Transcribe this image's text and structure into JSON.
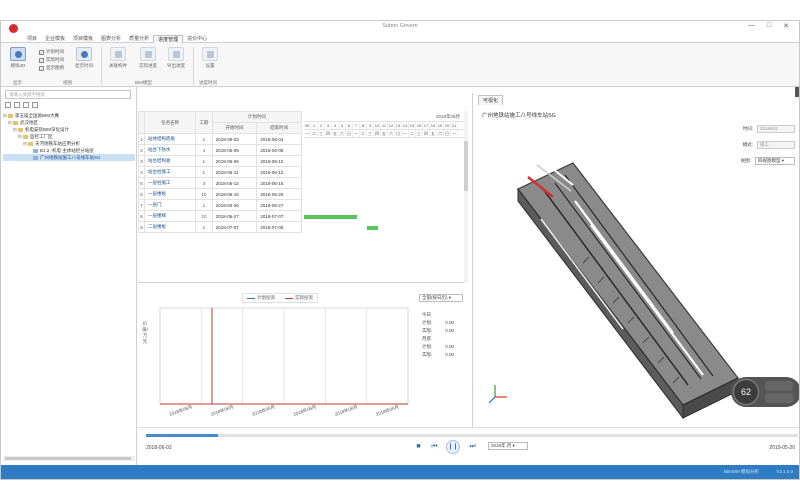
{
  "app": {
    "title": "Subon Govern",
    "status_text": "BimSIM 模拟分析",
    "version": "V3.1.0.0"
  },
  "window": {
    "minimize": "—",
    "maximize": "□",
    "close": "✕"
  },
  "menu": {
    "tabs": [
      "项目",
      "企业模板",
      "项目模板",
      "图表分析",
      "质量分析",
      "进度管理",
      "造价中心"
    ],
    "active_index": 5
  },
  "ribbon": {
    "buttons": [
      {
        "label": "模拟4D",
        "state": "active"
      },
      {
        "label": "显示时间",
        "state": "normal"
      },
      {
        "label": "关联构件",
        "state": "dim"
      },
      {
        "label": "实际进度",
        "state": "dim"
      },
      {
        "label": "导出进度",
        "state": "dim"
      },
      {
        "label": "设置",
        "state": "dim"
      }
    ],
    "checkboxes": [
      {
        "label": "计划时间",
        "checked": true
      },
      {
        "label": "实际时间",
        "checked": true
      },
      {
        "label": "显示图例",
        "checked": true
      }
    ],
    "groups": [
      "显示",
      "视图",
      "BIM模型",
      "进度时间"
    ]
  },
  "left_panel": {
    "search_placeholder": "请输入关键字搜索",
    "tree": [
      {
        "level": 0,
        "expander": "⊟",
        "folder": true,
        "label": "第五届全国质BIM大赛",
        "selected": false
      },
      {
        "level": 1,
        "expander": "⊟",
        "folder": true,
        "label": "武汉地区",
        "selected": false
      },
      {
        "level": 2,
        "expander": "⊟",
        "folder": true,
        "label": "机电安装BIM深化设计",
        "selected": false
      },
      {
        "level": 3,
        "expander": "⊟",
        "folder": true,
        "label": "监控工厂区",
        "selected": false
      },
      {
        "level": 4,
        "expander": "⊟",
        "folder": true,
        "label": "天河地铁车站应用分析",
        "selected": false
      },
      {
        "level": 5,
        "expander": "",
        "folder": false,
        "label": "B1.2 -机电 主体站控分站层",
        "selected": false
      },
      {
        "level": 5,
        "expander": "",
        "folder": false,
        "label": "广州地铁站施工八号线车站SG",
        "selected": true
      }
    ]
  },
  "gantt": {
    "headers": {
      "task": "任务名称",
      "duration": "工期",
      "plan": "计划时间",
      "start": "开始时间",
      "end": "结束时间"
    },
    "month": "2018年05月",
    "days": [
      "30",
      "1",
      "2",
      "3",
      "4",
      "5",
      "6",
      "7",
      "8",
      "9",
      "10",
      "11",
      "12",
      "13",
      "14",
      "15",
      "16",
      "17",
      "18",
      "19",
      "20",
      "21"
    ],
    "weekdays": [
      "一",
      "二",
      "三",
      "四",
      "五",
      "六",
      "日",
      "一",
      "二",
      "三",
      "四",
      "五",
      "六",
      "日",
      "一",
      "二",
      "三",
      "四",
      "五",
      "六",
      "日",
      "一"
    ],
    "rows": [
      {
        "id": "1",
        "name": "站体结构底板",
        "duration": "1",
        "start": "2018-06-03",
        "end": "2018-06-04"
      },
      {
        "id": "2",
        "name": "站台下防水",
        "duration": "4",
        "start": "2018-06-05",
        "end": "2018-06-08"
      },
      {
        "id": "3",
        "name": "站台结构板",
        "duration": "1",
        "start": "2018-06-09",
        "end": "2018-06-10"
      },
      {
        "id": "4",
        "name": "站台柱施工",
        "duration": "1",
        "start": "2018-06-11",
        "end": "2018-06-12"
      },
      {
        "id": "5",
        "name": "一层柱施工",
        "duration": "3",
        "start": "2018-06-12",
        "end": "2018-06-15"
      },
      {
        "id": "6",
        "name": "一层楼板",
        "duration": "10",
        "start": "2018-06-15",
        "end": "2018-06-25"
      },
      {
        "id": "7",
        "name": "一层门",
        "duration": "1",
        "start": "2018-06-26",
        "end": "2018-06-27"
      },
      {
        "id": "8",
        "name": "一层楼梯",
        "duration": "10",
        "start": "2018-06-27",
        "end": "2018-07-07"
      },
      {
        "id": "9",
        "name": "二层楼板",
        "duration": "1",
        "start": "2018-07-07",
        "end": "2018-07-08"
      }
    ],
    "bars": [
      {
        "row": 8,
        "start_day": 0,
        "length_days": 7.5
      },
      {
        "row": 9,
        "start_day": 9,
        "length_days": 1.5
      }
    ]
  },
  "chart_data": {
    "type": "line",
    "ylabel": "价值/万元",
    "series": [
      {
        "name": "计划投资",
        "color": "#3d6fb3"
      },
      {
        "name": "实际投资",
        "color": "#c0392b"
      }
    ],
    "x_ticks": [
      "2018年06月",
      "2018年06月",
      "2018年06月",
      "2018年06月",
      "2018年06月",
      "2018年06月"
    ],
    "select": "全部(按日历)",
    "stats": [
      {
        "section": "今日",
        "rows": [
          {
            "label": "计划:",
            "value": "0.00"
          },
          {
            "label": "实际:",
            "value": "0.00"
          }
        ]
      },
      {
        "section": "月底",
        "rows": [
          {
            "label": "计划:",
            "value": "0.00"
          },
          {
            "label": "实际:",
            "value": "0.00"
          }
        ]
      }
    ]
  },
  "view": {
    "tab": "可视化",
    "caption": "广州地铁站施工八号线车站SG",
    "time_label": "时间:",
    "time_value": "2018/6/3",
    "mode_label": "模式:",
    "mode_value": "施工",
    "display_label": "视图:",
    "display_value": "四视图模型",
    "zoom_value": "62"
  },
  "playback": {
    "start_date": "2018-06-03",
    "end_date": "2019-05-20",
    "progress": 0.11,
    "speed": "2018年 月",
    "stop_icon": "■",
    "prev_icon": "⏮",
    "play_icon": "❙❙",
    "next_icon": "⏭"
  }
}
